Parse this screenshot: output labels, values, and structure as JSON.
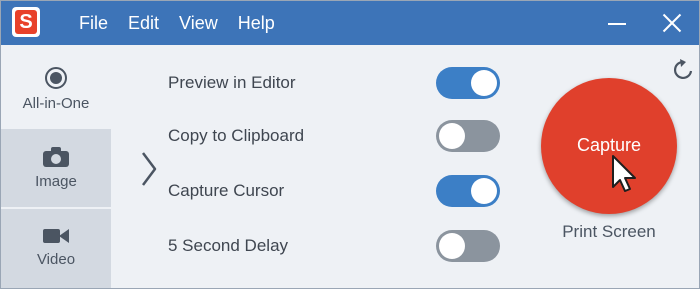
{
  "titlebar": {
    "logo_letter": "S",
    "menu": [
      "File",
      "Edit",
      "View",
      "Help"
    ]
  },
  "sidebar": {
    "items": [
      {
        "label": "All-in-One",
        "icon": "all-in-one-icon",
        "selected": true
      },
      {
        "label": "Image",
        "icon": "camera-icon",
        "selected": false
      },
      {
        "label": "Video",
        "icon": "video-icon",
        "selected": false
      }
    ]
  },
  "options": [
    {
      "label": "Preview in Editor",
      "on": true
    },
    {
      "label": "Copy to Clipboard",
      "on": false
    },
    {
      "label": "Capture Cursor",
      "on": true
    },
    {
      "label": "5 Second Delay",
      "on": false
    }
  ],
  "capture": {
    "label": "Capture",
    "hotkey": "Print Screen"
  },
  "colors": {
    "titlebar": "#3d74b8",
    "toggle_on": "#3c7fc6",
    "toggle_off": "#8b949e",
    "capture": "#e0402c",
    "logo": "#e8412a"
  }
}
